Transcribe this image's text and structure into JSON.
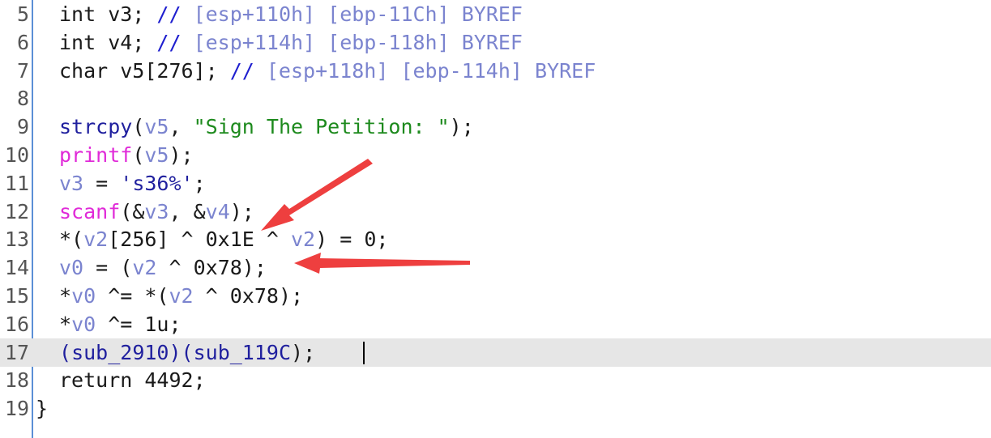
{
  "lines": [
    {
      "num": "5",
      "tokens": [
        {
          "t": "int",
          "c": "pl"
        },
        {
          "t": " v3; ",
          "c": "pl"
        },
        {
          "t": "//",
          "c": "cm"
        },
        {
          "t": " [esp+110h] [ebp-11Ch] BYREF",
          "c": "cmt"
        }
      ]
    },
    {
      "num": "6",
      "tokens": [
        {
          "t": "int",
          "c": "pl"
        },
        {
          "t": " v4; ",
          "c": "pl"
        },
        {
          "t": "//",
          "c": "cm"
        },
        {
          "t": " [esp+114h] [ebp-118h] BYREF",
          "c": "cmt"
        }
      ]
    },
    {
      "num": "7",
      "tokens": [
        {
          "t": "char v5[276]; ",
          "c": "pl"
        },
        {
          "t": "//",
          "c": "cm"
        },
        {
          "t": " [esp+118h] [ebp-114h] BYREF",
          "c": "cmt"
        }
      ]
    },
    {
      "num": "8",
      "tokens": []
    },
    {
      "num": "9",
      "tokens": [
        {
          "t": "strcpy",
          "c": "kw"
        },
        {
          "t": "(",
          "c": "pl"
        },
        {
          "t": "v5",
          "c": "var"
        },
        {
          "t": ", ",
          "c": "pl"
        },
        {
          "t": "\"Sign The Petition: \"",
          "c": "str"
        },
        {
          "t": ");",
          "c": "pl"
        }
      ]
    },
    {
      "num": "10",
      "tokens": [
        {
          "t": "printf",
          "c": "fn"
        },
        {
          "t": "(",
          "c": "pl"
        },
        {
          "t": "v5",
          "c": "var"
        },
        {
          "t": ");",
          "c": "pl"
        }
      ]
    },
    {
      "num": "11",
      "tokens": [
        {
          "t": "v3",
          "c": "var"
        },
        {
          "t": " = ",
          "c": "pl"
        },
        {
          "t": "'s36%'",
          "c": "kw"
        },
        {
          "t": ";",
          "c": "pl"
        }
      ]
    },
    {
      "num": "12",
      "tokens": [
        {
          "t": "scanf",
          "c": "fn"
        },
        {
          "t": "(&",
          "c": "pl"
        },
        {
          "t": "v3",
          "c": "var"
        },
        {
          "t": ", &",
          "c": "pl"
        },
        {
          "t": "v4",
          "c": "var"
        },
        {
          "t": ");",
          "c": "pl"
        }
      ]
    },
    {
      "num": "13",
      "tokens": [
        {
          "t": "*(",
          "c": "pl"
        },
        {
          "t": "v2",
          "c": "var"
        },
        {
          "t": "[256] ^ 0x1E ^ ",
          "c": "pl"
        },
        {
          "t": "v2",
          "c": "var"
        },
        {
          "t": ") = 0;",
          "c": "pl"
        }
      ]
    },
    {
      "num": "14",
      "tokens": [
        {
          "t": "v0",
          "c": "var"
        },
        {
          "t": " = (",
          "c": "pl"
        },
        {
          "t": "v2",
          "c": "var"
        },
        {
          "t": " ^ 0x78);",
          "c": "pl"
        }
      ]
    },
    {
      "num": "15",
      "tokens": [
        {
          "t": "*",
          "c": "pl"
        },
        {
          "t": "v0",
          "c": "var"
        },
        {
          "t": " ^= *(",
          "c": "pl"
        },
        {
          "t": "v2",
          "c": "var"
        },
        {
          "t": " ^ 0x78);",
          "c": "pl"
        }
      ]
    },
    {
      "num": "16",
      "tokens": [
        {
          "t": "*",
          "c": "pl"
        },
        {
          "t": "v0",
          "c": "var"
        },
        {
          "t": " ^= 1u;",
          "c": "pl"
        }
      ]
    },
    {
      "num": "17",
      "tokens": [
        {
          "t": "(",
          "c": "kw"
        },
        {
          "t": "sub_2910",
          "c": "kw"
        },
        {
          "t": ")(",
          "c": "kw"
        },
        {
          "t": "sub_119C",
          "c": "kw"
        },
        {
          "t": ");",
          "c": "pl"
        }
      ],
      "current": true
    },
    {
      "num": "18",
      "tokens": [
        {
          "t": "return 4492;",
          "c": "pl"
        }
      ]
    },
    {
      "num": "19",
      "tokens": [
        {
          "t": "}",
          "c": "pl"
        }
      ],
      "brace": true
    }
  ],
  "colors": {
    "plain": "#1a1a1a",
    "variable": "#7b84cf",
    "function": "#e02ad8",
    "string": "#1d8a1d",
    "keyword": "#1f1f9e",
    "comment": "#7b84cf",
    "arrow": "#ee3f3f",
    "current_line": "#e6e6e6",
    "gutter": "#5b8fd6"
  }
}
